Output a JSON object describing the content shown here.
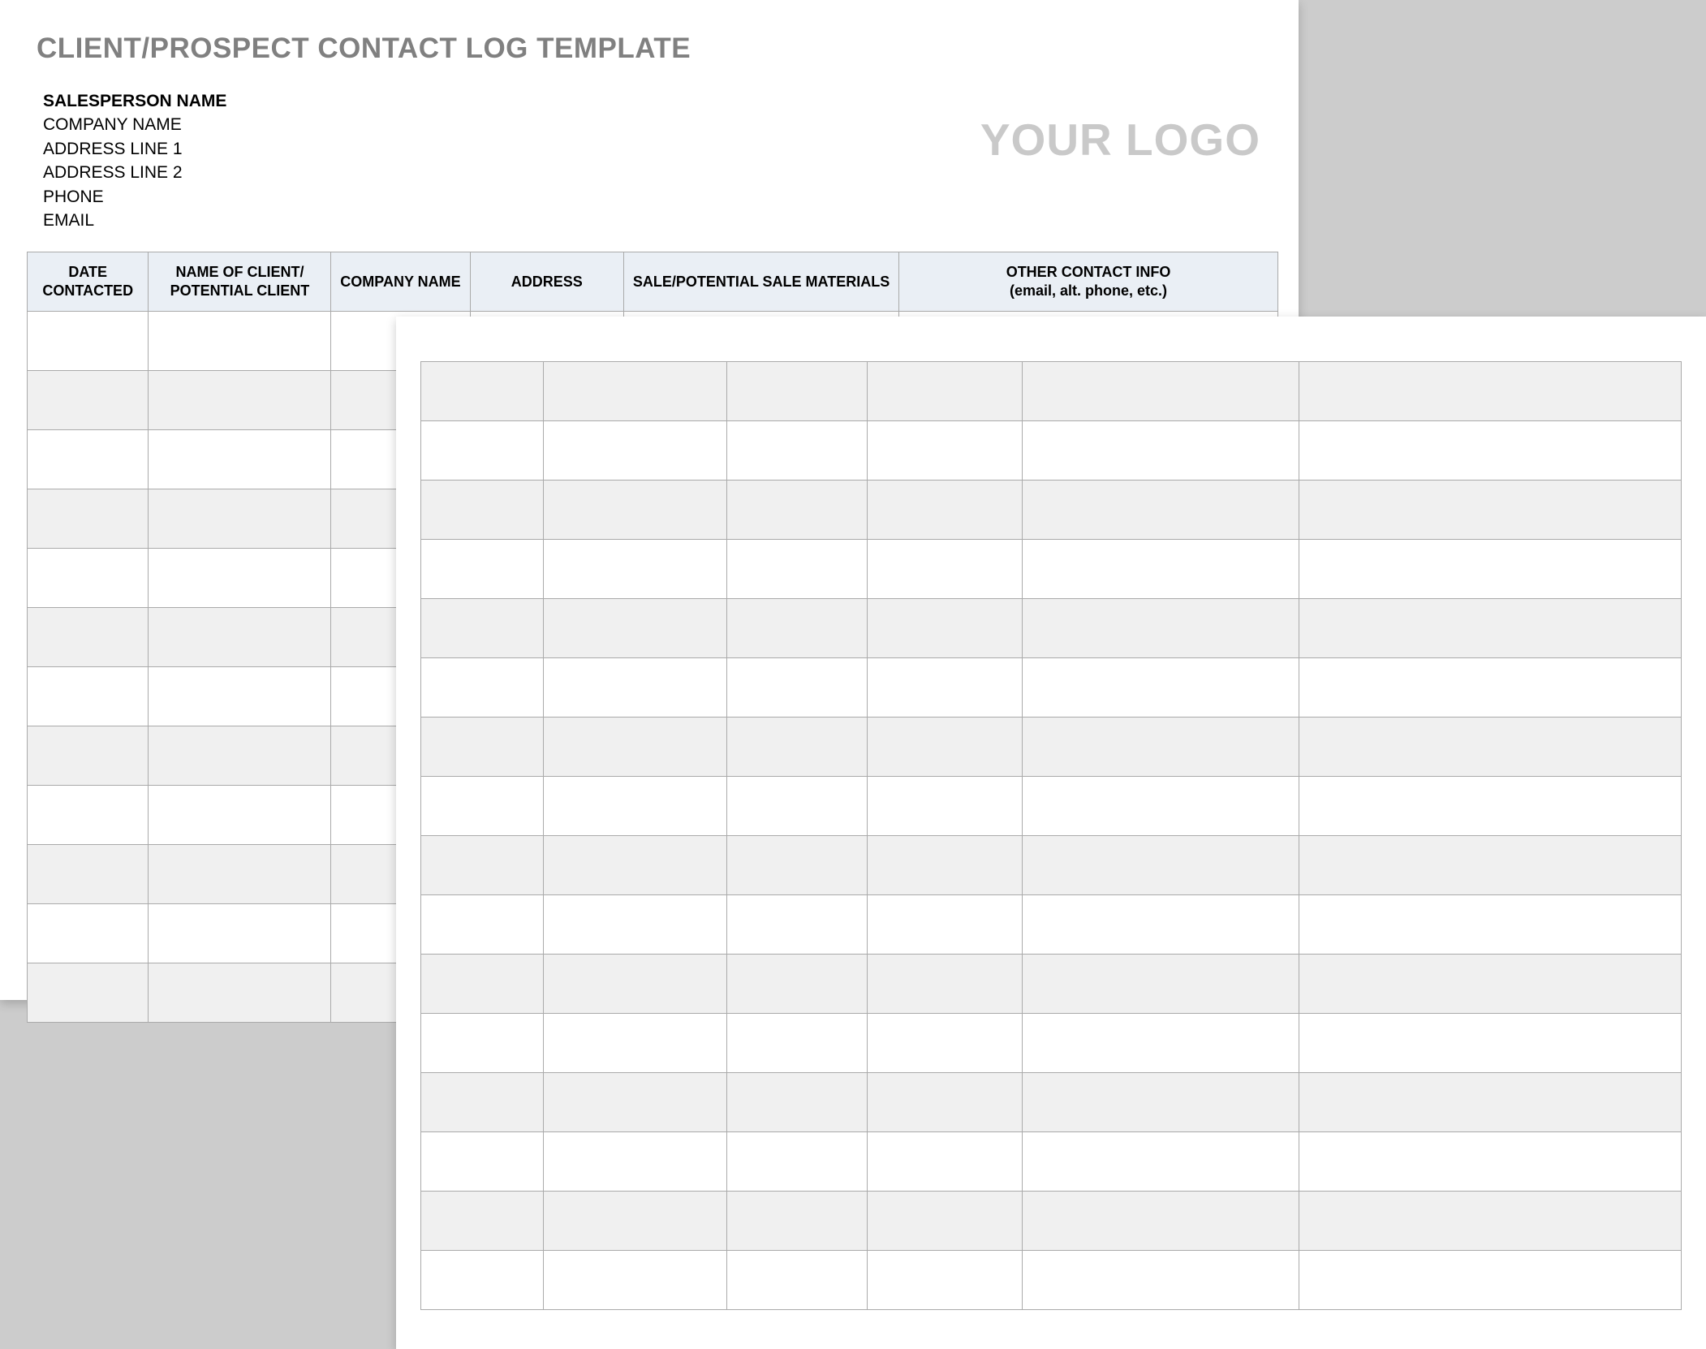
{
  "title": "CLIENT/PROSPECT CONTACT LOG TEMPLATE",
  "salesperson": {
    "name_label": "SALESPERSON NAME",
    "company": "COMPANY NAME",
    "address1": "ADDRESS LINE 1",
    "address2": "ADDRESS LINE 2",
    "phone": "PHONE",
    "email": "EMAIL"
  },
  "logo_placeholder": "YOUR LOGO",
  "columns": {
    "c1": "DATE CONTACTED",
    "c2": "NAME OF CLIENT/ POTENTIAL CLIENT",
    "c3": "COMPANY NAME",
    "c4": "ADDRESS",
    "c5": "SALE/POTENTIAL SALE MATERIALS",
    "c6a": "OTHER CONTACT INFO",
    "c6b": "(email, alt. phone, etc.)"
  }
}
